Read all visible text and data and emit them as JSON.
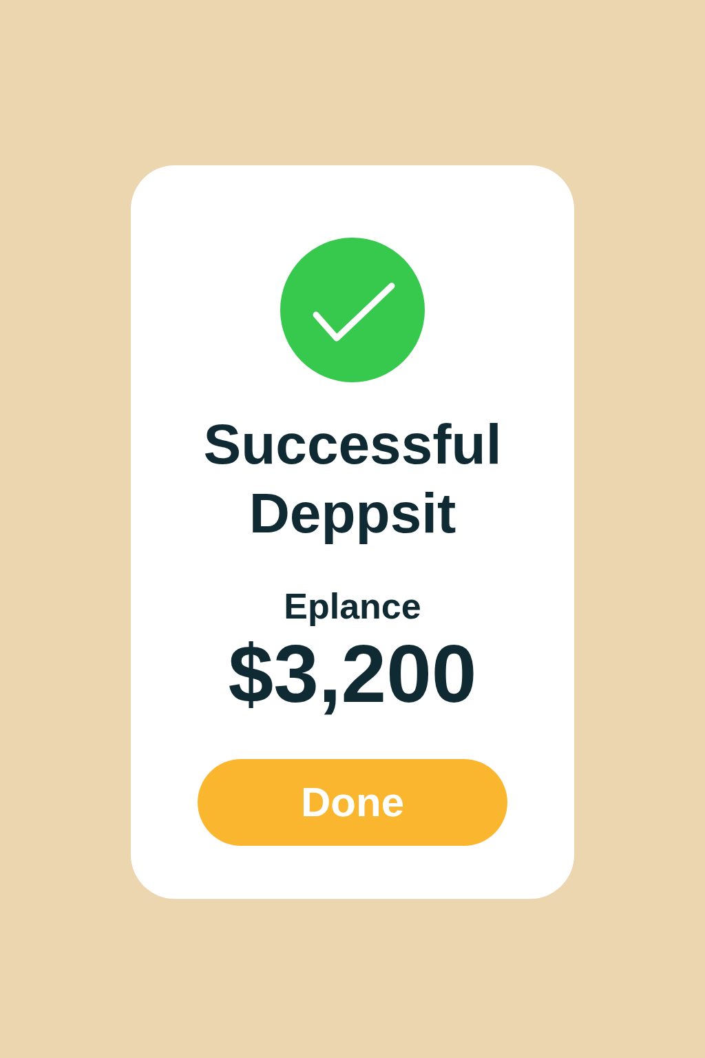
{
  "status": {
    "title": "Successful Deppsit"
  },
  "balance": {
    "label": "Eplance",
    "amount": "$3,200"
  },
  "buttons": [
    {
      "label": "Done",
      "kind": "primary"
    }
  ]
}
